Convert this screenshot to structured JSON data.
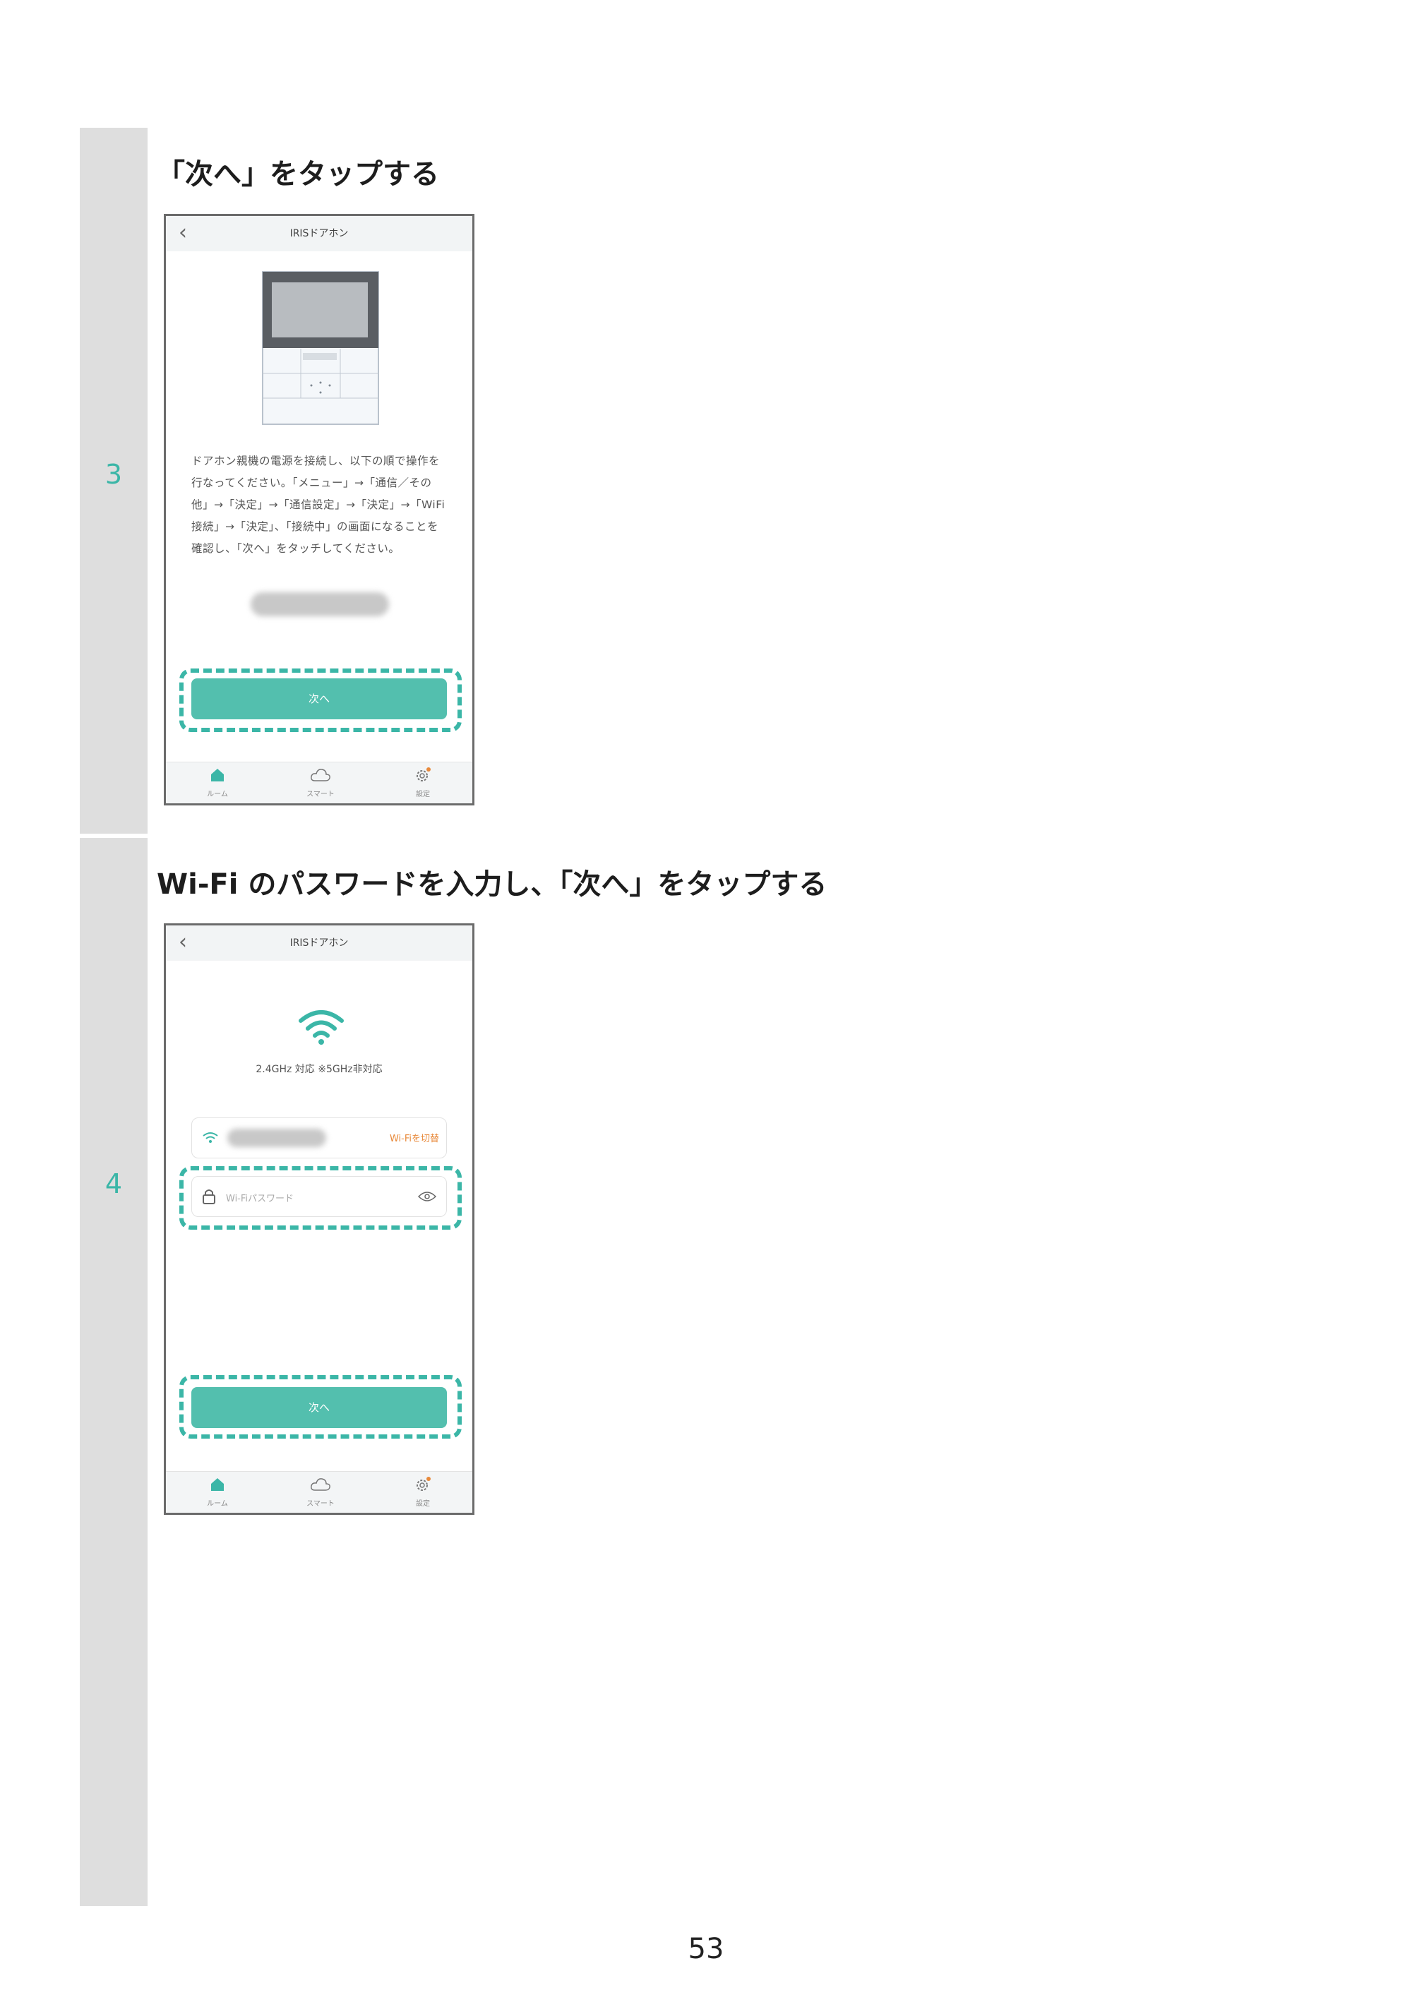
{
  "steps": [
    {
      "number": "3",
      "title": "「次へ」をタップする",
      "phone": {
        "header_title": "IRISドアホン",
        "instruction": "ドアホン親機の電源を接続し、以下の順で操作を行なってください。「メニュー」→「通信／その他」→「決定」→「通信設定」→「決定」→「WiFi接続」→「決定」、「接続中」の画面になることを確認し、「次へ」をタッチしてください。",
        "next_button": "次へ",
        "tabs": [
          "ルーム",
          "スマート",
          "設定"
        ]
      }
    },
    {
      "number": "4",
      "title": "Wi-Fi のパスワードを入力し、「次へ」をタップする",
      "phone": {
        "header_title": "IRISドアホン",
        "band_note": "2.4GHz 対応 ※5GHz非対応",
        "switch_wifi": "Wi-Fiを切替",
        "password_placeholder": "Wi-Fiパスワード",
        "next_button": "次へ",
        "tabs": [
          "ルーム",
          "スマート",
          "設定"
        ]
      }
    }
  ],
  "page_number": "53",
  "colors": {
    "accent": "#53bfae",
    "dash": "#3bb6a7",
    "gutter": "#dedede",
    "orange": "#e8893a"
  }
}
